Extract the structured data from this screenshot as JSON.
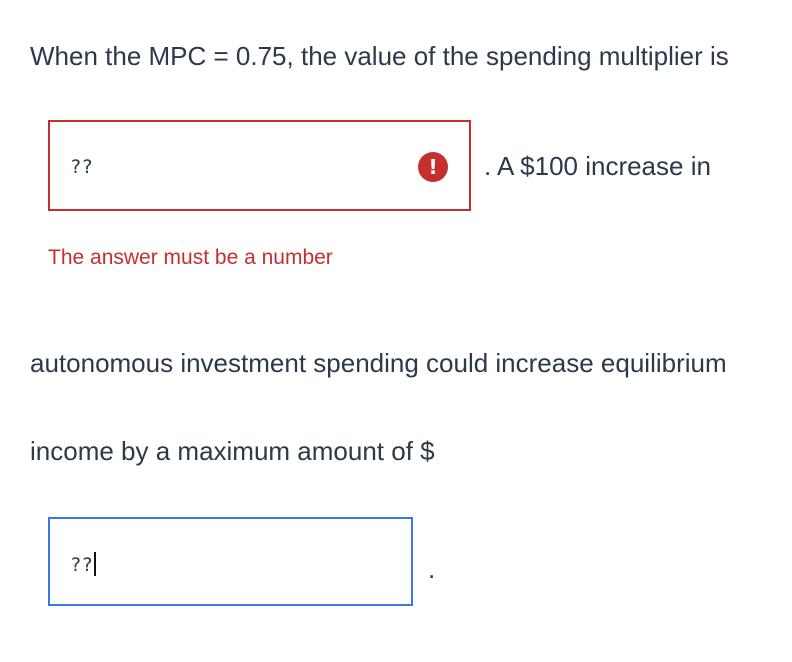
{
  "question": {
    "line1": "When the MPC = 0.75, the value of the spending multiplier is",
    "after_first_field": ". A $100 increase in",
    "line3": "autonomous investment spending could increase equilibrium",
    "line4": "income by a maximum amount of $",
    "after_second_field": "."
  },
  "multiplier_field": {
    "value": "??",
    "state": "error",
    "error_icon": "exclamation-icon",
    "error_symbol": "!",
    "error_message": "The answer must be a number"
  },
  "amount_field": {
    "value": "??",
    "state": "focused"
  },
  "colors": {
    "text": "#2b3a4a",
    "error": "#c62f2f",
    "focus": "#3b78e7"
  }
}
